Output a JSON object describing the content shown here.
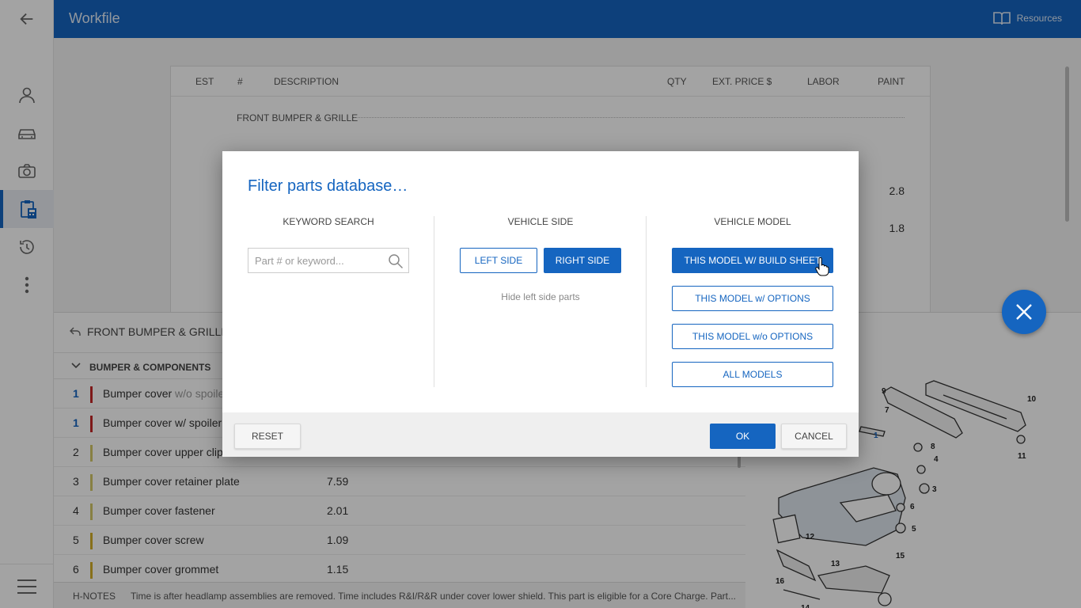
{
  "app": {
    "title": "Workfile",
    "resources_label": "Resources"
  },
  "estimate": {
    "columns": {
      "est": "EST",
      "num": "#",
      "description": "DESCRIPTION",
      "qty": "QTY",
      "ext_price": "EXT. PRICE $",
      "labor": "LABOR",
      "paint": "PAINT"
    },
    "section_title": "FRONT BUMPER & GRILLE",
    "paint_values": [
      "2.8",
      "1.8"
    ]
  },
  "parts_panel": {
    "breadcrumb": "FRONT BUMPER & GRILLE",
    "group_title": "BUMPER & COMPONENTS",
    "rows": [
      {
        "qty": "1",
        "desc": "Bumper cover",
        "modifier": "w/o spoile",
        "price": "",
        "color": "#c62828",
        "selected": true
      },
      {
        "qty": "1",
        "desc": "Bumper cover w/ spoiler",
        "modifier": "",
        "price": "",
        "color": "#c62828",
        "selected": true
      },
      {
        "qty": "2",
        "desc": "Bumper cover upper clip",
        "modifier": "",
        "price": "",
        "color": "#d4c86a",
        "selected": false
      },
      {
        "qty": "3",
        "desc": "Bumper cover retainer plate",
        "modifier": "",
        "price": "7.59",
        "color": "#d4c86a",
        "selected": false
      },
      {
        "qty": "4",
        "desc": "Bumper cover fastener",
        "modifier": "",
        "price": "2.01",
        "color": "#d4c86a",
        "selected": false
      },
      {
        "qty": "5",
        "desc": "Bumper cover screw",
        "modifier": "",
        "price": "1.09",
        "color": "#d4b02a",
        "selected": false
      },
      {
        "qty": "6",
        "desc": "Bumper cover grommet",
        "modifier": "",
        "price": "1.15",
        "color": "#d4b02a",
        "selected": false
      }
    ],
    "notes_label": "H-NOTES",
    "notes_text": "Time is after headlamp assemblies are removed. Time includes R&I/R&R under cover lower shield. This part is eligible for a Core Charge. Part...",
    "diagram_callouts": [
      "9",
      "10",
      "7",
      "1",
      "8",
      "4",
      "11",
      "3",
      "12",
      "6",
      "5",
      "13",
      "16",
      "15",
      "14"
    ]
  },
  "dialog": {
    "title": "Filter parts database…",
    "keyword": {
      "header": "KEYWORD SEARCH",
      "placeholder": "Part # or keyword..."
    },
    "vehicle_side": {
      "header": "VEHICLE SIDE",
      "left": "LEFT SIDE",
      "right": "RIGHT SIDE",
      "hint": "Hide left side parts"
    },
    "vehicle_model": {
      "header": "VEHICLE MODEL",
      "options": [
        "THIS MODEL W/ BUILD SHEET",
        "THIS MODEL w/ OPTIONS",
        "THIS MODEL w/o OPTIONS",
        "ALL MODELS"
      ]
    },
    "reset": "RESET",
    "ok": "OK",
    "cancel": "CANCEL"
  },
  "colors": {
    "primary": "#1565c0",
    "overlay": "rgba(0,0,0,0.36)"
  }
}
